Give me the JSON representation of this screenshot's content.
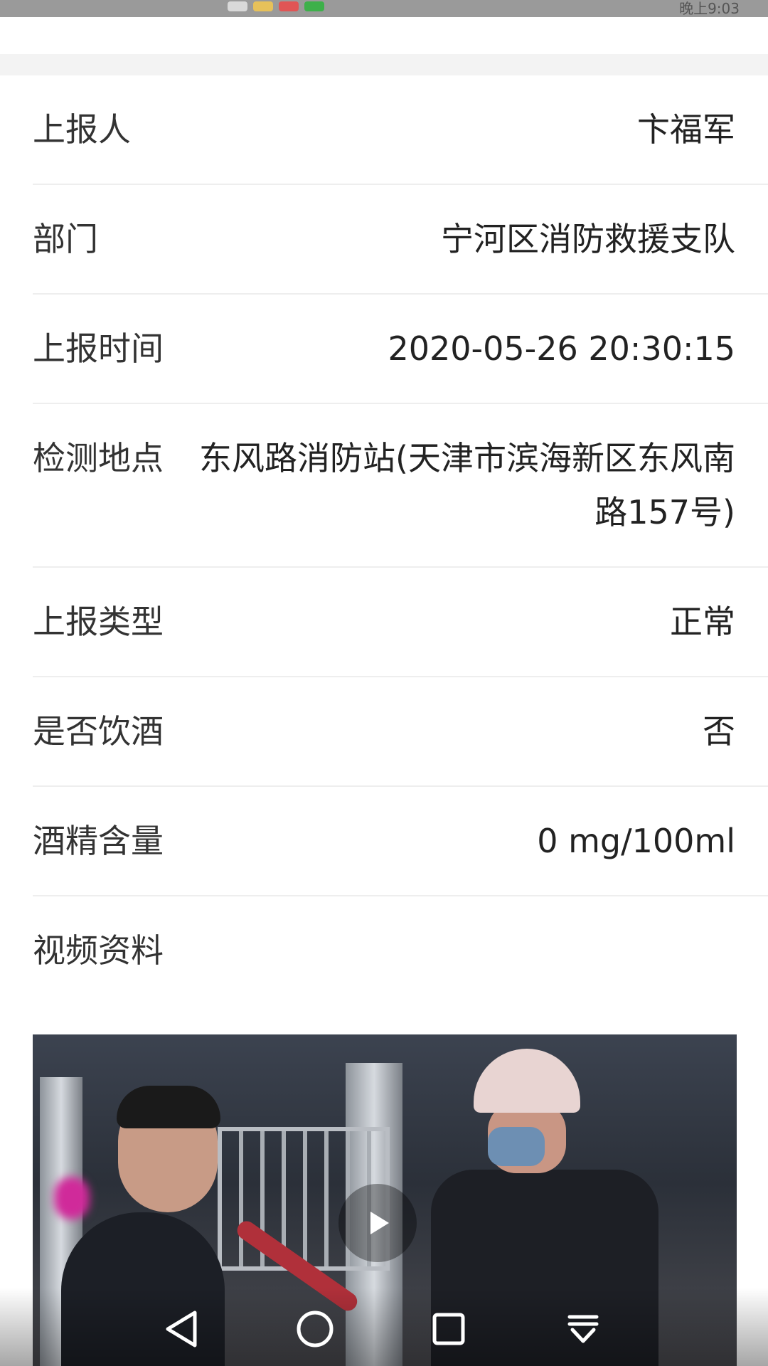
{
  "status_bar": {
    "clock": "晚上9:03"
  },
  "details": [
    {
      "label": "上报人",
      "value": "卞福军"
    },
    {
      "label": "部门",
      "value": "宁河区消防救援支队"
    },
    {
      "label": "上报时间",
      "value": "2020-05-26 20:30:15"
    },
    {
      "label": "检测地点",
      "value": "东风路消防站(天津市滨海新区东风南路157号)"
    },
    {
      "label": "上报类型",
      "value": "正常"
    },
    {
      "label": "是否饮酒",
      "value": "否"
    },
    {
      "label": "酒精含量",
      "value": "0 mg/100ml"
    }
  ],
  "video_section": {
    "title": "视频资料"
  },
  "icons": {
    "play": "play-icon",
    "nav_back": "back-triangle-icon",
    "nav_home": "home-circle-icon",
    "nav_recent": "recent-square-icon",
    "nav_menu": "pulldown-menu-icon"
  },
  "colors": {
    "divider": "#eeeeee",
    "label": "#333333",
    "value": "#222222"
  }
}
